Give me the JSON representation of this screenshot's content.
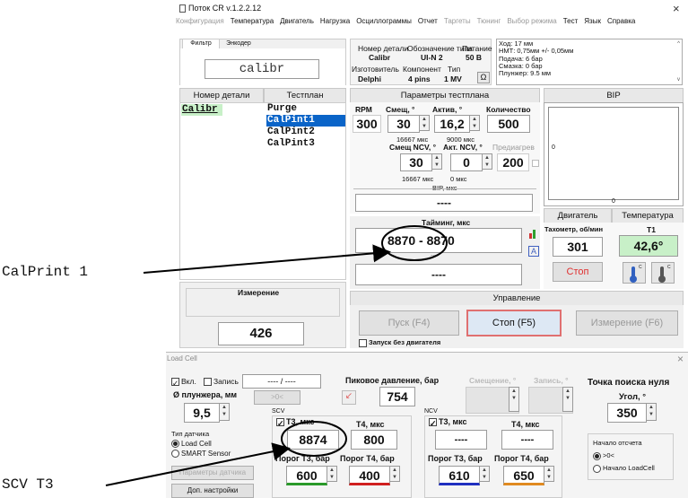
{
  "window": {
    "title": "Поток CR v.1.2.2.12",
    "close": "×"
  },
  "menu": [
    {
      "label": "Конфигурация",
      "enabled": false
    },
    {
      "label": "Температура",
      "enabled": true
    },
    {
      "label": "Двигатель",
      "enabled": true
    },
    {
      "label": "Нагрузка",
      "enabled": true
    },
    {
      "label": "Осциллограммы",
      "enabled": true
    },
    {
      "label": "Отчет",
      "enabled": true
    },
    {
      "label": "Таргеты",
      "enabled": false
    },
    {
      "label": "Тюнинг",
      "enabled": false
    },
    {
      "label": "Выбор режима",
      "enabled": false
    },
    {
      "label": "Тест",
      "enabled": true
    },
    {
      "label": "Язык",
      "enabled": true
    },
    {
      "label": "Справка",
      "enabled": true
    }
  ],
  "tabs": [
    "Фильтр",
    "Энкодер"
  ],
  "filter": {
    "value": "calibr"
  },
  "part_table": {
    "h_part": "Номер детали",
    "h_plan": "Тестплан",
    "part": "Calibr",
    "plans": [
      "Purge",
      "CalPint1",
      "CalPint2",
      "CalPint3"
    ],
    "selected": 1
  },
  "info": {
    "h1": "Номер детали",
    "h2": "Обозначение типа",
    "h3": "Питание",
    "v1": "Calibr",
    "v2": "UI-N 2",
    "v3": "50 В",
    "h4": "Изготовитель",
    "h5": "Компонент",
    "h6": "Тип",
    "v4": "Delphi",
    "v5": "4 pins",
    "v6": "1 MV",
    "ohm": "Ω"
  },
  "notes": [
    "Ход: 17 мм",
    "НМТ: 0,75мм +/- 0,05мм",
    "Подача: 6 бар",
    "Смазка: 0 бар",
    "Плунжер: 9.5 мм"
  ],
  "params": {
    "title": "Параметры тестплана",
    "rpm_l": "RPM",
    "off_l": "Смещ, °",
    "act_l": "Актив, °",
    "cnt_l": "Количество",
    "rpm": "300",
    "off": "30",
    "act": "16,2",
    "cnt": "500",
    "us1": "16667 мкс",
    "us2": "9000 мкс",
    "ncv_off_l": "Смещ NCV, °",
    "ncv_act_l": "Акт. NCV, °",
    "pre_l": "Предиагрев",
    "ncv_off": "30",
    "ncv_act": "0",
    "pre": "200",
    "us3": "16667 мкс",
    "us4": "0 мкс",
    "vr_l": "ВIP, мкс",
    "vr": "----"
  },
  "bip": {
    "title": "ВIP",
    "zero1": "0",
    "zero2": "0"
  },
  "timing": {
    "title": "Тайминг, мкс",
    "v1": "8870",
    "dash": "-",
    "v2": "8870",
    "small": "----",
    "v3": "----"
  },
  "engine": {
    "title": "Двигатель",
    "tach_l": "Тахометр, об/мин",
    "tach": "301",
    "stop": "Стоп"
  },
  "temp": {
    "title": "Температура",
    "t1_l": "T1",
    "t1": "42,6°",
    "c1": "С",
    "c2": "С"
  },
  "measure": {
    "title": "Измерение",
    "value": "426"
  },
  "control": {
    "title": "Управление",
    "start": "Пуск (F4)",
    "stop": "Стоп (F5)",
    "meas": "Измерение (F6)",
    "no_engine": "Запуск без двигателя"
  },
  "load_cell": {
    "title": "Load Cell",
    "close": "×",
    "on_l": "Вкл.",
    "rec_l": "Запись",
    "field": "---- / ----",
    "peak_l": "Пиковое давление, бар",
    "peak": "754",
    "shift_l": "Смещение, °",
    "rec2_l": "Запись, °",
    "plunger_l": "Ø плунжера, мм",
    "plunger": "9,5",
    "zero_btn": ">0<",
    "sensor_l": "Тип датчика",
    "s1": "Load Cell",
    "s2": "SMART Sensor",
    "sensor_btn": "Параметры датчика",
    "more_btn": "Доп. настройки",
    "scv": "SCV",
    "ncv": "NCV",
    "t3_l": "T3, мкс",
    "t4_l": "T4, мкс",
    "t3": "8874",
    "t4": "800",
    "nt3_l": "T3, мкс",
    "nt4_l": "T4, мкс",
    "nt3": "----",
    "nt4": "----",
    "p3_l": "Порог T3, бар",
    "p4_l": "Порог T4, бар",
    "p3": "600",
    "p4": "400",
    "np3_l": "Порог T3, бар",
    "np4_l": "Порог T4, бар",
    "np3": "610",
    "np4": "650",
    "search_l": "Точка поиска нуля",
    "angle_l": "Угол, °",
    "angle": "350",
    "start_l": "Начало отсчета",
    "r1": ">0<",
    "r2": "Начало LoadCell"
  },
  "callouts": {
    "c1": "CalPrint 1",
    "c2": "SCV T3"
  },
  "colors": {
    "accent": "#0078d7",
    "selection": "#0a64c8",
    "green_cell": "#c8f0c8",
    "stop_red": "#e03030",
    "underline_green": "#2a9a2a",
    "underline_red": "#d02020",
    "underline_blue": "#2030c0",
    "underline_orange": "#e08a20"
  }
}
